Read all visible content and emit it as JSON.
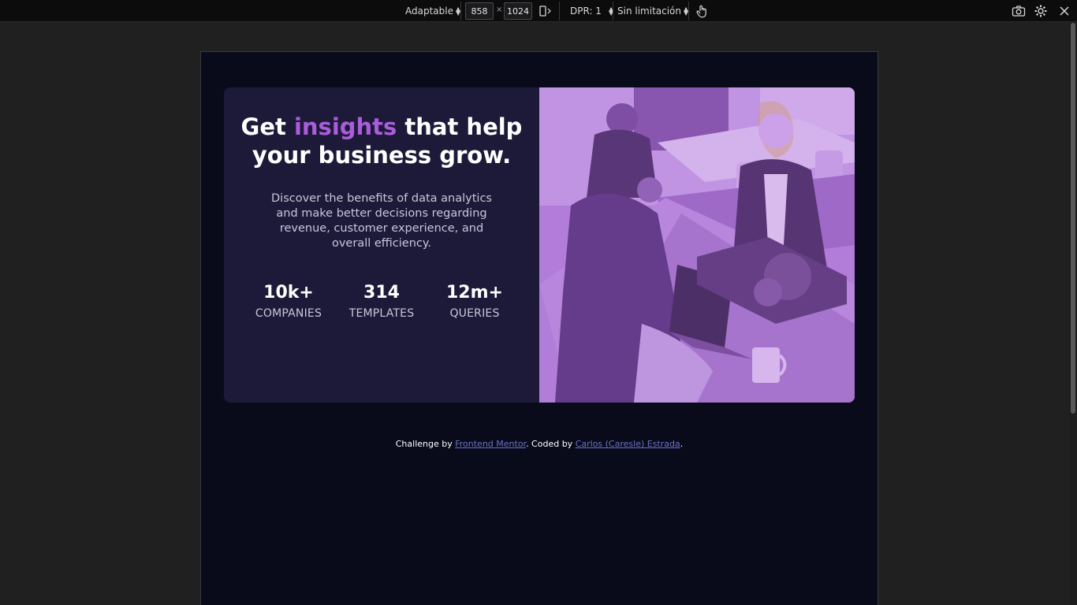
{
  "toolbar": {
    "device_select": "Adaptable",
    "width_value": "858",
    "height_value": "1024",
    "times_symbol": "×",
    "dpr_select": "DPR: 1",
    "throttle_select": "Sin limitación",
    "icons": [
      "rotate-icon",
      "touch-icon",
      "screenshot-icon",
      "settings-icon",
      "close-icon"
    ]
  },
  "card": {
    "headline": {
      "prefix": "Get ",
      "accent": "insights",
      "suffix": " that help your business grow."
    },
    "description": "Discover the benefits of data analytics and make better decisions regarding revenue, customer experience, and overall efficiency.",
    "stats": [
      {
        "value": "10k+",
        "label": "COMPANIES"
      },
      {
        "value": "314",
        "label": "TEMPLATES"
      },
      {
        "value": "12m+",
        "label": "QUERIES"
      }
    ],
    "image_alt": "people working in an office"
  },
  "attribution": {
    "prefix": "Challenge by ",
    "link1": "Frontend Mentor",
    "middle": ". Coded by ",
    "link2": "Carlos (Caresle) Estrada",
    "suffix": "."
  },
  "colors": {
    "page_bg": "#090b1a",
    "card_bg": "#1c1a38",
    "accent": "#aa5cdb",
    "text_muted": "#c9c7d8",
    "link": "#6a71c7"
  }
}
